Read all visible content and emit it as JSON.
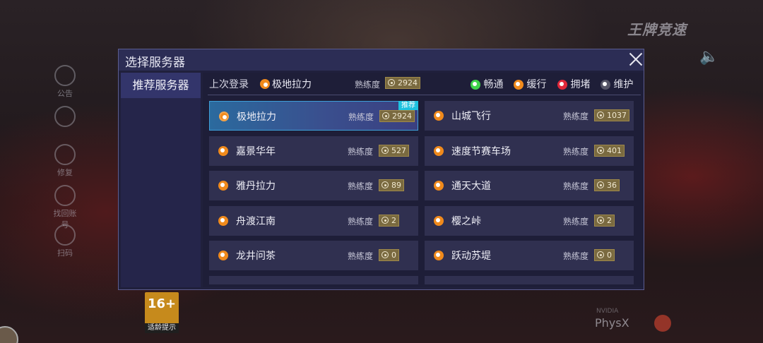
{
  "background": {
    "logo": "王牌竞速",
    "side_buttons": [
      {
        "label": "公告",
        "icon": "megaphone-icon"
      },
      {
        "label": "",
        "icon": "document-icon"
      },
      {
        "label": "修复",
        "icon": "wrench-icon"
      },
      {
        "label": "找回账号",
        "icon": "search-user-icon"
      },
      {
        "label": "扫码",
        "icon": "qr-icon"
      }
    ],
    "age_rating": "16+",
    "age_tip": "适龄提示",
    "physx": "PhysX",
    "nvidia": "NVIDIA"
  },
  "dialog": {
    "title": "选择服务器",
    "tab": "推荐服务器",
    "last_login_label": "上次登录",
    "last_login_server": "极地拉力",
    "proficiency_label": "熟练度",
    "last_login_proficiency": "2924",
    "legend": [
      {
        "label": "畅通",
        "color": "#3ed24a"
      },
      {
        "label": "缓行",
        "color": "#f08a1c"
      },
      {
        "label": "拥堵",
        "color": "#e0283a"
      },
      {
        "label": "维护",
        "color": "#555566"
      }
    ],
    "recommend_badge": "推荐",
    "servers": [
      {
        "name": "极地拉力",
        "proficiency": "2924",
        "status_color": "#f08a1c",
        "selected": true,
        "recommended": true
      },
      {
        "name": "山城飞行",
        "proficiency": "1037",
        "status_color": "#f08a1c"
      },
      {
        "name": "嘉景华年",
        "proficiency": "527",
        "status_color": "#f08a1c"
      },
      {
        "name": "速度节赛车场",
        "proficiency": "401",
        "status_color": "#f08a1c"
      },
      {
        "name": "雅丹拉力",
        "proficiency": "89",
        "status_color": "#f08a1c"
      },
      {
        "name": "通天大道",
        "proficiency": "36",
        "status_color": "#f08a1c"
      },
      {
        "name": "舟渡江南",
        "proficiency": "2",
        "status_color": "#f08a1c"
      },
      {
        "name": "樱之峠",
        "proficiency": "2",
        "status_color": "#f08a1c"
      },
      {
        "name": "龙井问茶",
        "proficiency": "0",
        "status_color": "#f08a1c"
      },
      {
        "name": "跃动苏堤",
        "proficiency": "0",
        "status_color": "#f08a1c"
      }
    ]
  }
}
